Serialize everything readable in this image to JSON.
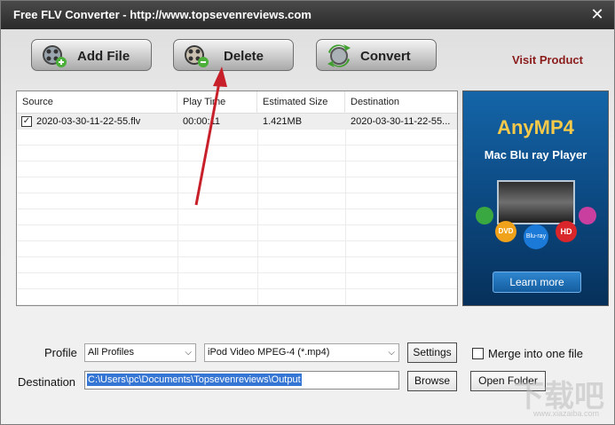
{
  "window": {
    "title": "Free FLV Converter - http://www.topsevenreviews.com"
  },
  "toolbar": {
    "add_file_label": "Add File",
    "delete_label": "Delete",
    "convert_label": "Convert",
    "visit_label": "Visit Product"
  },
  "table": {
    "headers": [
      "Source",
      "Play Time",
      "Estimated Size",
      "Destination"
    ],
    "rows": [
      {
        "checked": true,
        "source": "2020-03-30-11-22-55.flv",
        "play_time": "00:00:11",
        "size": "1.421MB",
        "destination": "2020-03-30-11-22-55..."
      }
    ]
  },
  "ad": {
    "title": "AnyMP4",
    "subtitle": "Mac Blu ray Player",
    "button": "Learn more",
    "disc_labels": [
      "DVD",
      "Blu-ray",
      "HD"
    ]
  },
  "bottom": {
    "profile_label": "Profile",
    "profile_category": "All Profiles",
    "profile_format": "iPod Video MPEG-4 (*.mp4)",
    "settings_label": "Settings",
    "merge_label": "Merge into one file",
    "merge_checked": false,
    "destination_label": "Destination",
    "destination_value": "C:\\Users\\pc\\Documents\\Topsevenreviews\\Output",
    "browse_label": "Browse",
    "open_folder_label": "Open Folder"
  },
  "colors": {
    "title_bar": "#2f2f2f",
    "visit_product": "#8b1c1c",
    "annotation_arrow": "#c8202a",
    "ad_background": "#0d4c86"
  },
  "watermark": {
    "text": "下载吧",
    "site": "www.xiazaiba.com"
  }
}
